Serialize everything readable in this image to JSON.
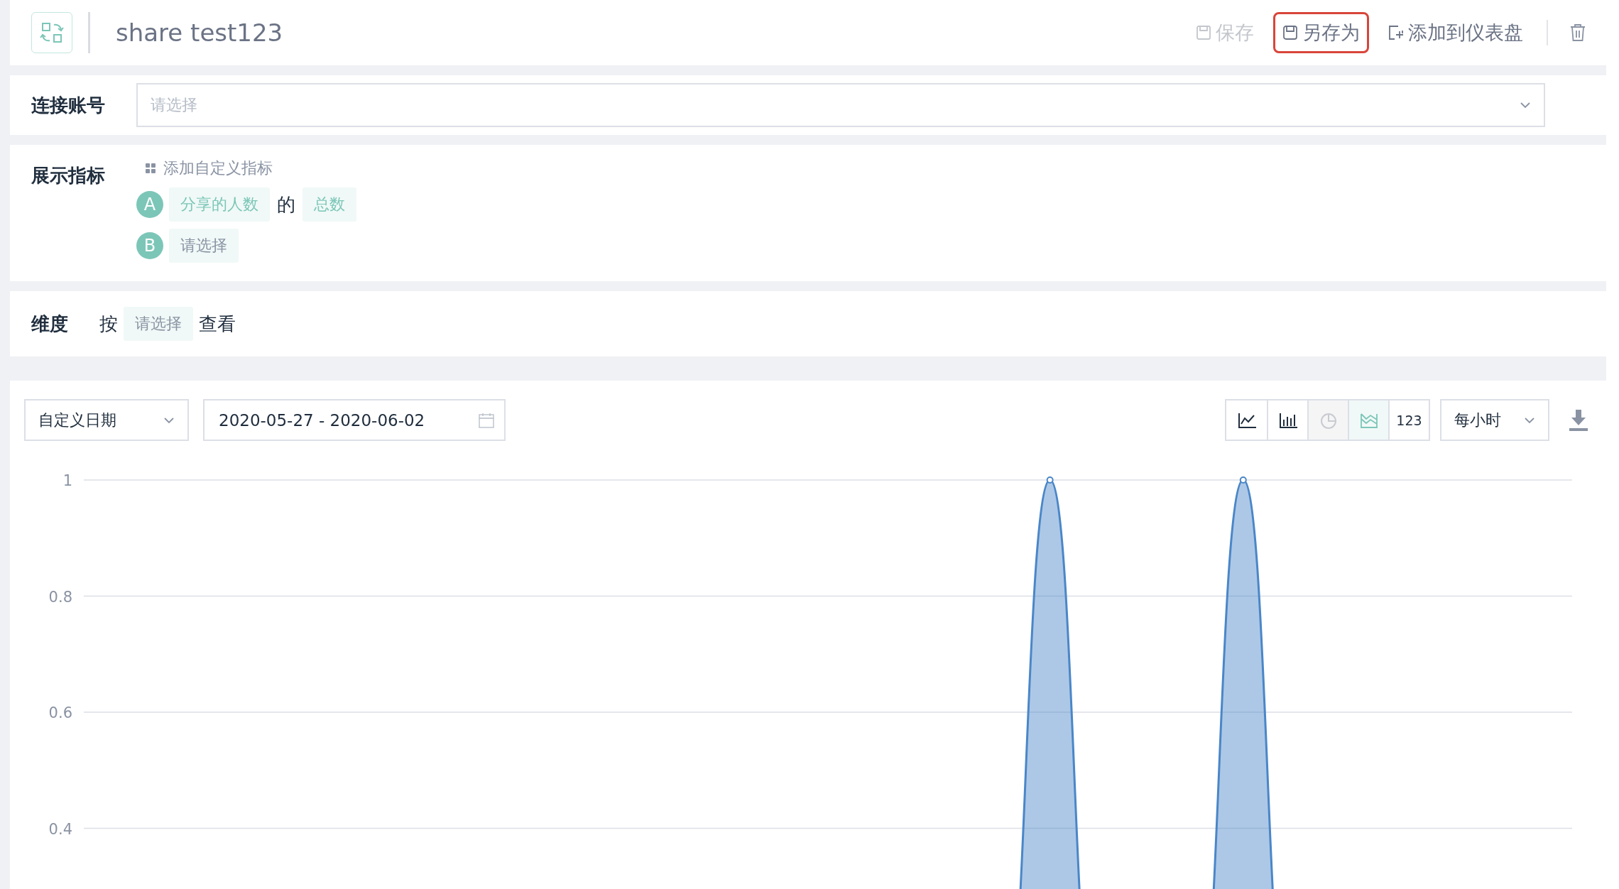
{
  "header": {
    "title": "share test123",
    "actions": [
      {
        "kind": "save",
        "label": "保存",
        "disabled": true,
        "highlighted": false
      },
      {
        "kind": "save_as",
        "label": "另存为",
        "disabled": false,
        "highlighted": true
      },
      {
        "kind": "add",
        "label": "添加到仪表盘",
        "disabled": false,
        "highlighted": false
      }
    ]
  },
  "account": {
    "label": "连接账号",
    "placeholder": "请选择"
  },
  "metrics": {
    "label": "展示指标",
    "add_label": "添加自定义指标",
    "items": [
      {
        "letter": "A",
        "parts": [
          {
            "kind": "chip",
            "text": "分享的人数",
            "filled": true
          },
          {
            "kind": "word",
            "text": "的"
          },
          {
            "kind": "chip",
            "text": "总数",
            "filled": true
          }
        ]
      },
      {
        "letter": "B",
        "parts": [
          {
            "kind": "chip",
            "text": "请选择",
            "filled": false
          }
        ]
      }
    ]
  },
  "dimension": {
    "label": "维度",
    "prefix": "按",
    "chip": "请选择",
    "suffix": "查看"
  },
  "toolbar": {
    "date_mode": "自定义日期",
    "date_range": "2020-05-27 - 2020-06-02",
    "chart_types": [
      {
        "kind": "line",
        "selected": false,
        "disabled": false
      },
      {
        "kind": "bar",
        "selected": false,
        "disabled": false
      },
      {
        "kind": "pie",
        "selected": false,
        "disabled": true
      },
      {
        "kind": "area",
        "selected": true,
        "disabled": false
      },
      {
        "kind": "number",
        "label": "123",
        "selected": false,
        "disabled": false
      }
    ],
    "interval": "每小时"
  },
  "chart": {
    "chart_data": {
      "type": "area",
      "grid": true,
      "ylim": [
        0,
        1
      ],
      "yticks": [
        0.4,
        0.6,
        0.8,
        1
      ],
      "series": [
        {
          "color": "#4a86c8",
          "values": [
            0,
            0,
            0,
            0,
            0,
            0,
            0,
            0,
            0,
            0,
            0,
            0,
            0,
            0,
            0,
            0,
            0,
            0,
            0,
            0,
            1,
            0,
            0,
            0,
            1,
            0,
            0,
            0,
            0,
            0,
            0,
            0
          ]
        }
      ]
    }
  }
}
